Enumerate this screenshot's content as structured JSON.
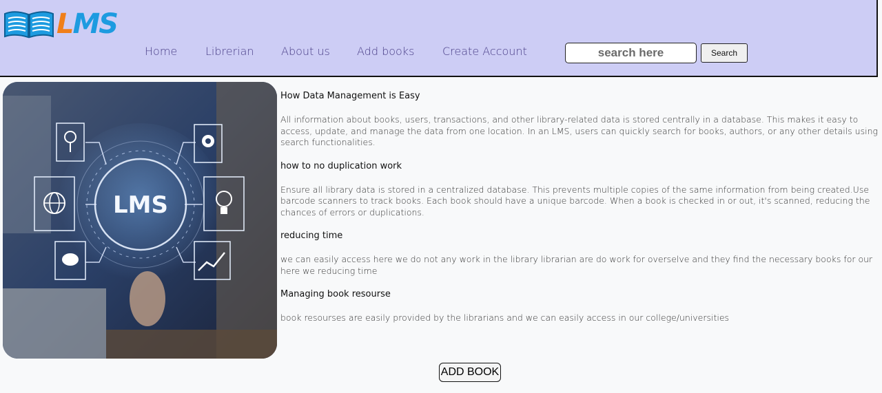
{
  "header": {
    "logo_text_l": "L",
    "logo_text_ms": "MS",
    "nav": [
      {
        "label": "Home"
      },
      {
        "label": "Librerian"
      },
      {
        "label": "About us"
      },
      {
        "label": "Add books"
      },
      {
        "label": "Create Account"
      }
    ],
    "search": {
      "placeholder": "search here",
      "value": "",
      "button_label": "Search"
    }
  },
  "hero": {
    "overlay_text": "LMS",
    "icons": [
      "search-icon",
      "gear-head-icon",
      "globe-icon",
      "lightbulb-icon",
      "chat-bubble-icon",
      "trend-chart-icon"
    ]
  },
  "sections": [
    {
      "heading": "How Data Management is Easy",
      "body": "All information about books, users, transactions, and other library-related data is stored centrally in a database. This makes it easy to access, update, and manage the data from one location. In an LMS, users can quickly search for books, authors, or any other details using search functionalities."
    },
    {
      "heading": "how to no duplication work",
      "body": "Ensure all library data is stored in a centralized database. This prevents multiple copies of the same information from being created.Use barcode scanners to track books. Each book should have a unique barcode. When a book is checked in or out, it's scanned, reducing the chances of errors or duplications."
    },
    {
      "heading": "reducing time",
      "body": "we can easily access here we do not any work in the library librarian are do work for overselve and they find the necessary books for our here we reducing time"
    },
    {
      "heading": "Managing book resourse",
      "body": "book resourses are easily provided by the librarians and we can easily access in our college/universities"
    }
  ],
  "add_book_label": "ADD BOOK",
  "colors": {
    "header_bg": "#cdcdf5",
    "nav_text": "#4a3f88",
    "logo_orange": "#f07f1a",
    "logo_blue": "#1d9be0"
  }
}
